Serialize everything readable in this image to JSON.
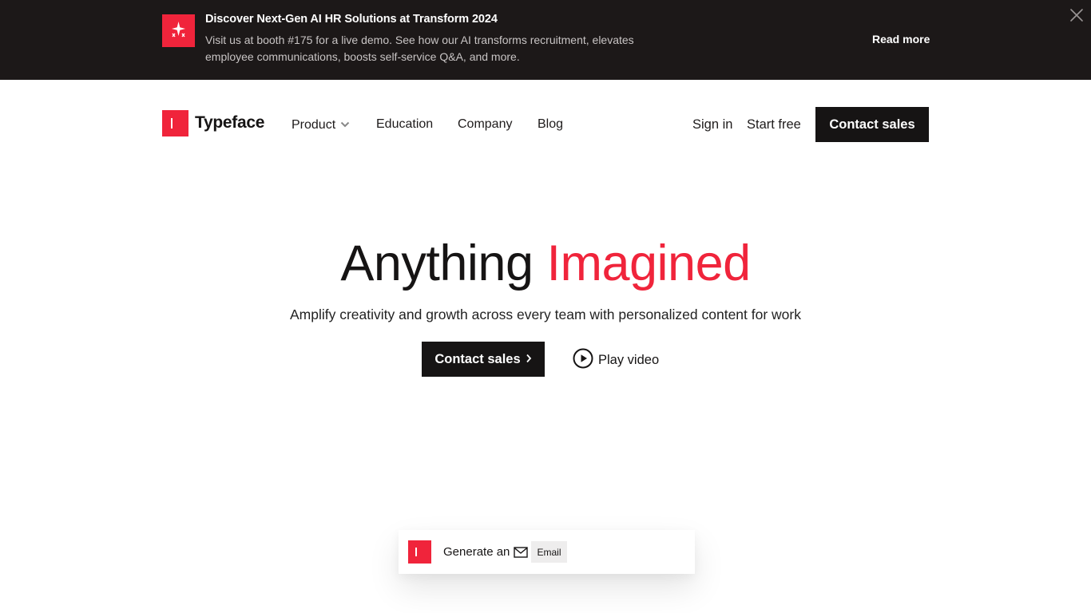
{
  "banner": {
    "title": "Discover Next-Gen AI HR Solutions at Transform 2024",
    "text": "Visit us at booth #175 for a live demo. See how our AI transforms recruitment, elevates employee communications, boosts self-service Q&A, and more.",
    "read_more": "Read more",
    "icon": "sparkles-icon",
    "close_icon": "close-icon"
  },
  "nav": {
    "brand": "Typeface",
    "items": [
      {
        "label": "Product"
      },
      {
        "label": "Education"
      },
      {
        "label": "Company"
      },
      {
        "label": "Blog"
      }
    ],
    "sign_in": "Sign in",
    "start_free": "Start free",
    "contact_sales": "Contact sales"
  },
  "hero": {
    "title_main": "Anything",
    "title_accent": "Imagined",
    "subtitle": "Amplify creativity and growth across every team with personalized content for work",
    "cta": "Contact sales",
    "cta_icon": "chevron-right-icon",
    "play_video": "Play video",
    "play_icon": "play-circle-icon"
  },
  "generator": {
    "label": "Generate an",
    "chip": "Email",
    "chip_icon": "mail-icon"
  },
  "colors": {
    "brand_red": "#f0243b",
    "dark": "#161414",
    "banner_bg": "#1c1818"
  }
}
